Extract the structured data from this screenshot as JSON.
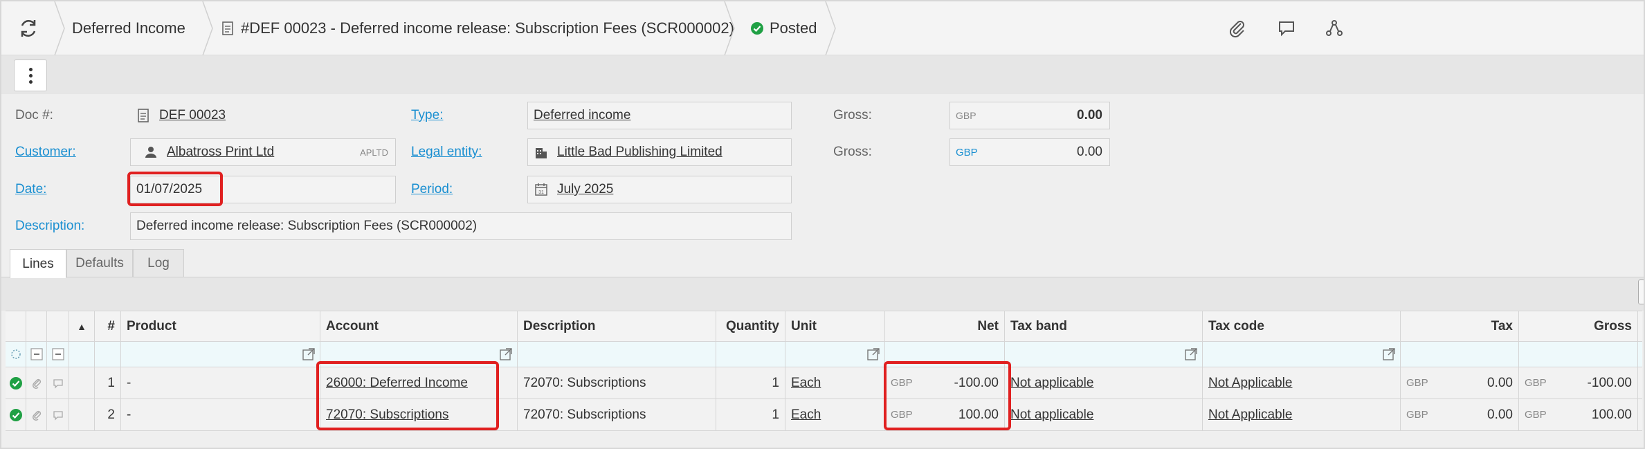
{
  "breadcrumb": {
    "section": "Deferred Income",
    "document": "#DEF 00023 - Deferred income release: Subscription Fees (SCR000002)",
    "status": "Posted"
  },
  "header_icons": [
    "paperclip-icon",
    "comment-icon",
    "share-icon"
  ],
  "form": {
    "doc_label": "Doc #:",
    "doc_value": "DEF 00023",
    "type_label": "Type:",
    "type_value": "Deferred income",
    "gross_label_1": "Gross:",
    "gross_currency_1": "GBP",
    "gross_value_1": "0.00",
    "customer_label": "Customer:",
    "customer_value": "Albatross Print Ltd",
    "customer_code": "APLTD",
    "legal_entity_label": "Legal entity:",
    "legal_entity_value": "Little Bad Publishing Limited",
    "gross_label_2": "Gross:",
    "gross_currency_2": "GBP",
    "gross_value_2": "0.00",
    "date_label": "Date:",
    "date_value": "01/07/2025",
    "period_label": "Period:",
    "period_value": "July 2025",
    "description_label": "Description:",
    "description_value": "Deferred income release: Subscription Fees (SCR000002)"
  },
  "tabs": [
    "Lines",
    "Defaults",
    "Log"
  ],
  "active_tab": "Lines",
  "grid": {
    "sort_indicator": "▲",
    "columns": [
      "#",
      "Product",
      "Account",
      "Description",
      "Quantity",
      "Unit",
      "Net",
      "Tax band",
      "Tax code",
      "Tax",
      "Gross"
    ],
    "rows": [
      {
        "num": "1",
        "product": "-",
        "account": "26000: Deferred Income",
        "description": "72070: Subscriptions",
        "quantity": "1",
        "unit": "Each",
        "net_cur": "GBP",
        "net": "-100.00",
        "tax_band": "Not applicable",
        "tax_code": "Not Applicable",
        "tax_cur": "GBP",
        "tax": "0.00",
        "gross_cur": "GBP",
        "gross": "-100.00"
      },
      {
        "num": "2",
        "product": "-",
        "account": "72070: Subscriptions",
        "description": "72070: Subscriptions",
        "quantity": "1",
        "unit": "Each",
        "net_cur": "GBP",
        "net": "100.00",
        "tax_band": "Not applicable",
        "tax_code": "Not Applicable",
        "tax_cur": "GBP",
        "tax": "0.00",
        "gross_cur": "GBP",
        "gross": "100.00"
      }
    ]
  },
  "colors": {
    "link": "#1a8fd1",
    "highlight": "#e02020",
    "posted": "#1fa044"
  }
}
